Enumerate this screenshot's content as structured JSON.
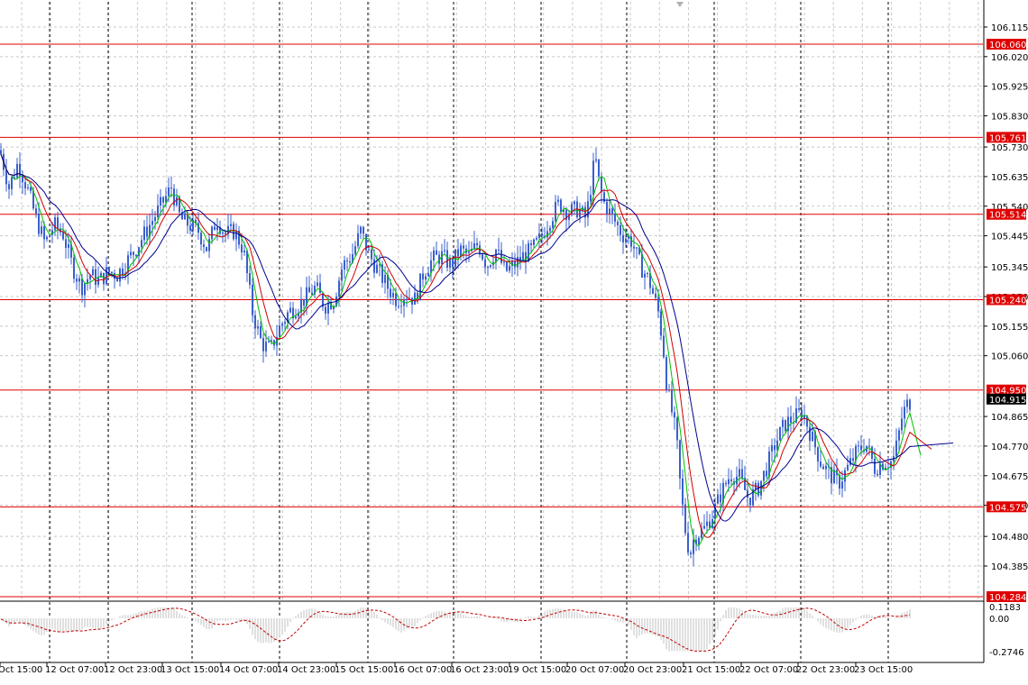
{
  "chart_data": [
    {
      "type": "candlestick",
      "title": "",
      "price_axis": {
        "ticks": [
          "106.115",
          "106.020",
          "105.925",
          "105.830",
          "105.730",
          "105.635",
          "105.540",
          "105.445",
          "105.345",
          "105.250",
          "105.155",
          "105.060",
          "104.865",
          "104.770",
          "104.675",
          "104.580",
          "104.480",
          "104.385"
        ],
        "ylim": [
          104.284,
          106.115
        ]
      },
      "time_axis": {
        "labels": [
          "Oct 15:00",
          "12 Oct 07:00",
          "12 Oct 23:00",
          "13 Oct 15:00",
          "14 Oct 07:00",
          "14 Oct 23:00",
          "15 Oct 15:00",
          "16 Oct 07:00",
          "16 Oct 23:00",
          "19 Oct 15:00",
          "20 Oct 07:00",
          "20 Oct 23:00",
          "21 Oct 15:00",
          "22 Oct 07:00",
          "22 Oct 23:00",
          "23 Oct 15:00"
        ]
      },
      "horizontal_levels": [
        {
          "value": 106.06,
          "label": "106.060",
          "color": "#e00000"
        },
        {
          "value": 105.761,
          "label": "105.761",
          "color": "#e00000"
        },
        {
          "value": 105.514,
          "label": "105.514",
          "color": "#e00000"
        },
        {
          "value": 105.24,
          "label": "105.240",
          "color": "#e00000"
        },
        {
          "value": 104.95,
          "label": "104.950",
          "color": "#e00000"
        },
        {
          "value": 104.575,
          "label": "104.575",
          "color": "#e00000"
        },
        {
          "value": 104.284,
          "label": "104.284",
          "color": "#e00000"
        }
      ],
      "current_price": {
        "value": 104.915,
        "label": "104.915"
      },
      "price_anchors": [
        [
          0,
          105.72
        ],
        [
          10,
          105.6
        ],
        [
          20,
          105.68
        ],
        [
          30,
          105.6
        ],
        [
          40,
          105.5
        ],
        [
          50,
          105.42
        ],
        [
          60,
          105.48
        ],
        [
          70,
          105.45
        ],
        [
          80,
          105.35
        ],
        [
          90,
          105.28
        ],
        [
          100,
          105.32
        ],
        [
          110,
          105.3
        ],
        [
          120,
          105.33
        ],
        [
          130,
          105.32
        ],
        [
          140,
          105.36
        ],
        [
          150,
          105.4
        ],
        [
          160,
          105.45
        ],
        [
          170,
          105.5
        ],
        [
          180,
          105.55
        ],
        [
          190,
          105.6
        ],
        [
          200,
          105.5
        ],
        [
          210,
          105.48
        ],
        [
          220,
          105.46
        ],
        [
          230,
          105.4
        ],
        [
          240,
          105.5
        ],
        [
          250,
          105.45
        ],
        [
          260,
          105.46
        ],
        [
          270,
          105.4
        ],
        [
          275,
          105.3
        ],
        [
          280,
          105.2
        ],
        [
          290,
          105.1
        ],
        [
          300,
          105.08
        ],
        [
          310,
          105.15
        ],
        [
          320,
          105.2
        ],
        [
          330,
          105.22
        ],
        [
          340,
          105.25
        ],
        [
          350,
          105.28
        ],
        [
          360,
          105.22
        ],
        [
          370,
          105.24
        ],
        [
          380,
          105.35
        ],
        [
          390,
          105.38
        ],
        [
          400,
          105.46
        ],
        [
          410,
          105.38
        ],
        [
          420,
          105.33
        ],
        [
          430,
          105.28
        ],
        [
          440,
          105.24
        ],
        [
          450,
          105.26
        ],
        [
          460,
          105.24
        ],
        [
          470,
          105.33
        ],
        [
          480,
          105.37
        ],
        [
          490,
          105.38
        ],
        [
          500,
          105.35
        ],
        [
          510,
          105.4
        ],
        [
          520,
          105.38
        ],
        [
          530,
          105.42
        ],
        [
          540,
          105.35
        ],
        [
          550,
          105.4
        ],
        [
          560,
          105.33
        ],
        [
          570,
          105.35
        ],
        [
          580,
          105.38
        ],
        [
          590,
          105.4
        ],
        [
          600,
          105.44
        ],
        [
          610,
          105.5
        ],
        [
          620,
          105.55
        ],
        [
          630,
          105.52
        ],
        [
          640,
          105.53
        ],
        [
          650,
          105.5
        ],
        [
          655,
          105.6
        ],
        [
          660,
          105.7
        ],
        [
          665,
          105.6
        ],
        [
          670,
          105.55
        ],
        [
          680,
          105.5
        ],
        [
          690,
          105.45
        ],
        [
          700,
          105.43
        ],
        [
          710,
          105.35
        ],
        [
          720,
          105.3
        ],
        [
          730,
          105.2
        ],
        [
          735,
          105.1
        ],
        [
          740,
          104.95
        ],
        [
          745,
          104.88
        ],
        [
          750,
          104.8
        ],
        [
          755,
          104.62
        ],
        [
          760,
          104.5
        ],
        [
          765,
          104.42
        ],
        [
          770,
          104.48
        ],
        [
          780,
          104.5
        ],
        [
          790,
          104.55
        ],
        [
          800,
          104.62
        ],
        [
          810,
          104.68
        ],
        [
          820,
          104.67
        ],
        [
          830,
          104.6
        ],
        [
          840,
          104.63
        ],
        [
          850,
          104.7
        ],
        [
          860,
          104.78
        ],
        [
          870,
          104.84
        ],
        [
          880,
          104.86
        ],
        [
          890,
          104.88
        ],
        [
          900,
          104.8
        ],
        [
          910,
          104.72
        ],
        [
          920,
          104.68
        ],
        [
          930,
          104.65
        ],
        [
          940,
          104.7
        ],
        [
          950,
          104.75
        ],
        [
          960,
          104.78
        ],
        [
          970,
          104.7
        ],
        [
          980,
          104.72
        ],
        [
          990,
          104.72
        ],
        [
          995,
          104.78
        ],
        [
          1000,
          104.86
        ],
        [
          1005,
          104.9
        ],
        [
          1010,
          104.915
        ]
      ],
      "moving_averages": [
        {
          "color": "#00c000",
          "lag": 2
        },
        {
          "color": "#d00000",
          "lag": 4
        },
        {
          "color": "#000090",
          "lag": 8
        }
      ]
    },
    {
      "type": "histogram",
      "title": "",
      "value_axis": {
        "ticks": [
          "0.1183",
          "0.00",
          "-0.2746"
        ],
        "ylim": [
          -0.2746,
          0.1183
        ]
      },
      "signal_color": "#c00000",
      "bar_color": "#c0c0c0"
    }
  ]
}
